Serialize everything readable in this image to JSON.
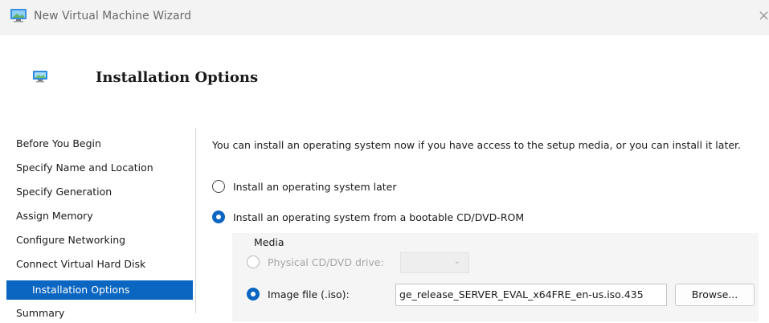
{
  "window": {
    "title": "New Virtual Machine Wizard",
    "close_glyph": "×",
    "app_icon": "virtual-machine-icon"
  },
  "header": {
    "title": "Installation Options",
    "icon": "monitor-icon"
  },
  "nav": {
    "items": [
      {
        "label": "Before You Begin",
        "active": false
      },
      {
        "label": "Specify Name and Location",
        "active": false
      },
      {
        "label": "Specify Generation",
        "active": false
      },
      {
        "label": "Assign Memory",
        "active": false
      },
      {
        "label": "Configure Networking",
        "active": false
      },
      {
        "label": "Connect Virtual Hard Disk",
        "active": false
      },
      {
        "label": "Installation Options",
        "active": true
      },
      {
        "label": "Summary",
        "active": false
      }
    ]
  },
  "content": {
    "intro": "You can install an operating system now if you have access to the setup media, or you can install it later.",
    "options": [
      {
        "label": "Install an operating system later",
        "selected": false
      },
      {
        "label": "Install an operating system from a bootable CD/DVD-ROM",
        "selected": true
      }
    ],
    "media": {
      "label": "Media",
      "physical_drive_label": "Physical CD/DVD drive:",
      "physical_drive_enabled": false,
      "physical_drive_value": "",
      "image_file_label": "Image file (.iso):",
      "image_file_selected": true,
      "image_file_value": "435.ge_release_SERVER_EVAL_x64FRE_en-us.iso",
      "browse_label": "Browse..."
    }
  },
  "colors": {
    "accent": "#0b66c2",
    "titlebar_bg": "#f3f3f3",
    "group_bg": "#f5f5f5"
  }
}
